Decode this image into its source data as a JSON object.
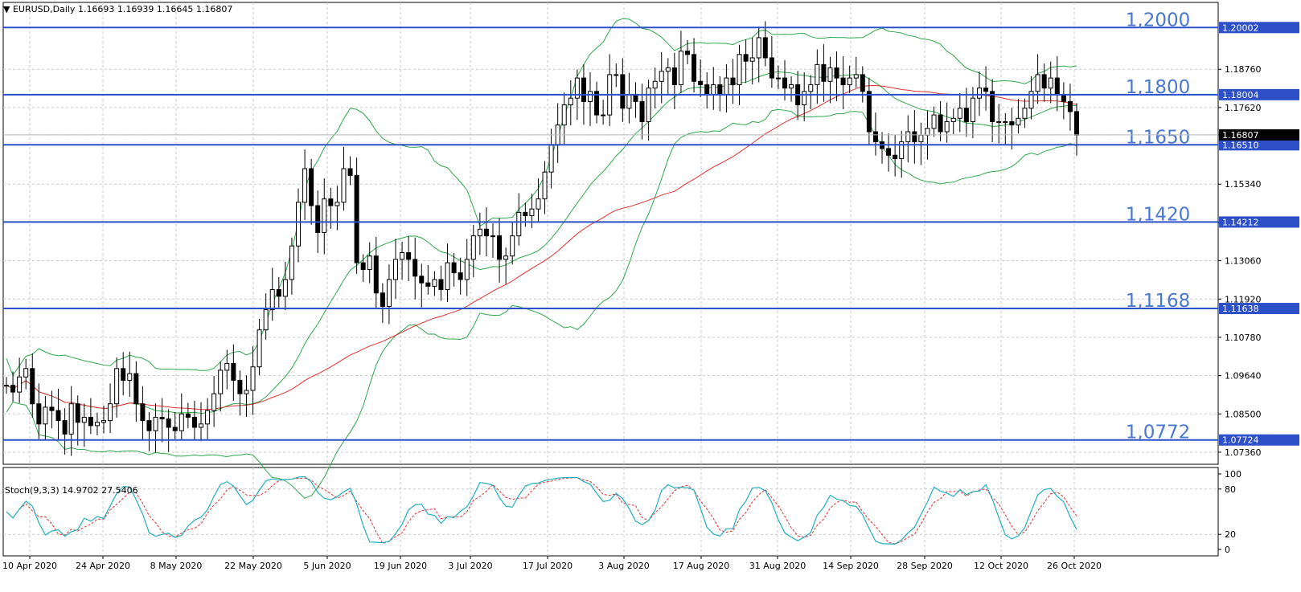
{
  "header": {
    "symbol_line": "EURUSD,Daily  1.16693 1.16939 1.16645 1.16807",
    "stoch_label": "Stoch(9,3,3) 14.9702 27.5406"
  },
  "colors": {
    "up_candle": "#ffffff",
    "down_candle": "#000000",
    "bollinger": "#2eaa4a",
    "ma": "#e53030",
    "level_line": "#2d50c8",
    "stoch_main": "#20b0c0",
    "stoch_signal": "#e53030",
    "grid": "#c8c8c8"
  },
  "chart_data": [
    {
      "type": "candlestick",
      "symbol": "EURUSD",
      "timeframe": "Daily",
      "ylim": [
        1.07,
        1.2075
      ],
      "yticks": [
        "1.18760",
        "1.17620",
        "1.16807",
        "1.15340",
        "1.14200",
        "1.13060",
        "1.11920",
        "1.10780",
        "1.09640",
        "1.08500",
        "1.07360"
      ],
      "xticks": [
        "10 Apr 2020",
        "24 Apr 2020",
        "8 May 2020",
        "22 May 2020",
        "5 Jun 2020",
        "19 Jun 2020",
        "3 Jul 2020",
        "17 Jul 2020",
        "3 Aug 2020",
        "17 Aug 2020",
        "31 Aug 2020",
        "14 Sep 2020",
        "28 Sep 2020",
        "12 Oct 2020",
        "26 Oct 2020"
      ],
      "current_price": "1.16807",
      "levels": [
        {
          "label": "1,2000",
          "tag": "1.20002",
          "value": 1.20002
        },
        {
          "label": "1,1800",
          "tag": "1.18004",
          "value": 1.18004
        },
        {
          "label": "1,1650",
          "tag": "1.16510",
          "value": 1.1651
        },
        {
          "label": "1,1420",
          "tag": "1.14212",
          "value": 1.14212
        },
        {
          "label": "1,1168",
          "tag": "1.11638",
          "value": 1.11638
        },
        {
          "label": "1,0772",
          "tag": "1.07724",
          "value": 1.07724
        }
      ],
      "close": [
        1.0935,
        1.0915,
        1.096,
        1.0985,
        1.088,
        1.082,
        1.087,
        1.086,
        1.083,
        1.079,
        1.088,
        1.0825,
        1.084,
        1.0815,
        1.0825,
        1.083,
        1.088,
        1.0985,
        1.095,
        1.097,
        1.088,
        1.083,
        1.08,
        1.084,
        1.0835,
        1.081,
        1.08,
        1.085,
        1.084,
        1.081,
        1.082,
        1.086,
        1.091,
        1.098,
        1.1,
        1.095,
        1.091,
        1.092,
        1.099,
        1.11,
        1.116,
        1.122,
        1.12,
        1.125,
        1.135,
        1.148,
        1.158,
        1.147,
        1.139,
        1.149,
        1.147,
        1.148,
        1.158,
        1.156,
        1.13,
        1.128,
        1.132,
        1.121,
        1.117,
        1.125,
        1.131,
        1.133,
        1.131,
        1.126,
        1.124,
        1.123,
        1.125,
        1.122,
        1.13,
        1.127,
        1.125,
        1.131,
        1.138,
        1.14,
        1.138,
        1.138,
        1.131,
        1.132,
        1.138,
        1.145,
        1.144,
        1.146,
        1.149,
        1.157,
        1.165,
        1.171,
        1.177,
        1.179,
        1.185,
        1.178,
        1.181,
        1.174,
        1.174,
        1.186,
        1.186,
        1.176,
        1.18,
        1.178,
        1.172,
        1.182,
        1.184,
        1.187,
        1.188,
        1.183,
        1.193,
        1.192,
        1.184,
        1.183,
        1.18,
        1.183,
        1.18,
        1.185,
        1.183,
        1.192,
        1.19,
        1.191,
        1.197,
        1.191,
        1.185,
        1.185,
        1.182,
        1.183,
        1.177,
        1.181,
        1.183,
        1.189,
        1.184,
        1.188,
        1.185,
        1.183,
        1.185,
        1.186,
        1.181,
        1.169,
        1.166,
        1.164,
        1.162,
        1.161,
        1.166,
        1.169,
        1.166,
        1.168,
        1.17,
        1.174,
        1.169,
        1.172,
        1.173,
        1.176,
        1.172,
        1.179,
        1.182,
        1.181,
        1.172,
        1.172,
        1.172,
        1.171,
        1.173,
        1.176,
        1.181,
        1.186,
        1.182,
        1.185,
        1.18,
        1.178,
        1.175,
        1.168
      ]
    },
    {
      "type": "line",
      "name": "Stoch(9,3,3)",
      "ylim": [
        0,
        100
      ],
      "yticks": [
        "100",
        "80",
        "20",
        "0"
      ],
      "values": [
        14.9702,
        27.5406
      ]
    }
  ]
}
